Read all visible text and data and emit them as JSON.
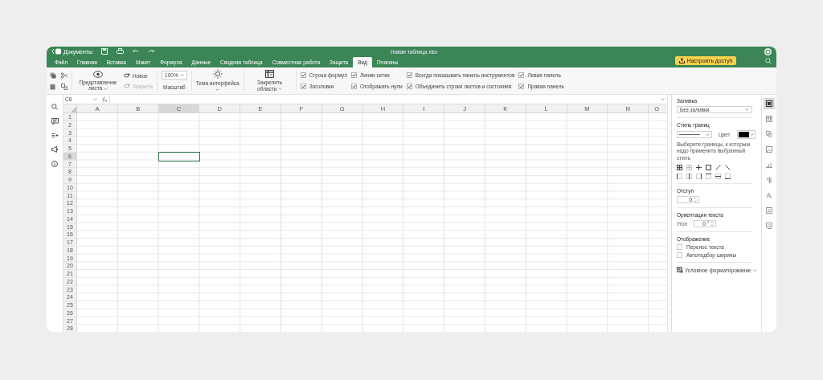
{
  "header": {
    "back_label": "Документы",
    "title": "Новая таблица.xlsx",
    "share_button": "Настроить доступ"
  },
  "menu": [
    {
      "label": "Файл",
      "selected": false
    },
    {
      "label": "Главная",
      "selected": false
    },
    {
      "label": "Вставка",
      "selected": false
    },
    {
      "label": "Макет",
      "selected": false
    },
    {
      "label": "Формула",
      "selected": false
    },
    {
      "label": "Данные",
      "selected": false
    },
    {
      "label": "Сводная таблица",
      "selected": false
    },
    {
      "label": "Совместная работа",
      "selected": false
    },
    {
      "label": "Защита",
      "selected": false
    },
    {
      "label": "Вид",
      "selected": true
    },
    {
      "label": "Плагины",
      "selected": false
    }
  ],
  "toolbar": {
    "sheet_view": "Представление листа",
    "new_view": "Новое",
    "close_view": {
      "label": "Закрыть",
      "disabled": true
    },
    "zoom_value": "100%",
    "zoom_label": "Масштаб",
    "theme": "Тема интерфейса",
    "freeze": "Закрепить области",
    "checkbox_columns": [
      {
        "items": [
          {
            "label": "Строка формул",
            "checked": true
          },
          {
            "label": "Заголовки",
            "checked": true
          }
        ]
      },
      {
        "items": [
          {
            "label": "Линии сетки",
            "checked": true
          },
          {
            "label": "Отображать нули",
            "checked": true
          }
        ]
      },
      {
        "items": [
          {
            "label": "Всегда показывать панель инструментов",
            "checked": true
          },
          {
            "label": "Объединить строки листов и состояния",
            "checked": true
          }
        ]
      },
      {
        "items": [
          {
            "label": "Левая панель",
            "checked": true
          },
          {
            "label": "Правая панель",
            "checked": true
          }
        ]
      }
    ]
  },
  "formula_bar": {
    "cell_ref": "C6"
  },
  "grid": {
    "columns": [
      {
        "label": "A",
        "selected": false
      },
      {
        "label": "B",
        "selected": false
      },
      {
        "label": "C",
        "selected": true
      },
      {
        "label": "D",
        "selected": false
      },
      {
        "label": "E",
        "selected": false
      },
      {
        "label": "F",
        "selected": false
      },
      {
        "label": "G",
        "selected": false
      },
      {
        "label": "H",
        "selected": false
      },
      {
        "label": "I",
        "selected": false
      },
      {
        "label": "J",
        "selected": false
      },
      {
        "label": "K",
        "selected": false
      },
      {
        "label": "L",
        "selected": false
      },
      {
        "label": "M",
        "selected": false
      },
      {
        "label": "N",
        "selected": false
      },
      {
        "label": "O",
        "selected": false
      }
    ],
    "rows": [
      {
        "label": "1",
        "selected": false
      },
      {
        "label": "2",
        "selected": false
      },
      {
        "label": "3",
        "selected": false
      },
      {
        "label": "4",
        "selected": false
      },
      {
        "label": "5",
        "selected": false
      },
      {
        "label": "6",
        "selected": true
      },
      {
        "label": "7",
        "selected": false
      },
      {
        "label": "8",
        "selected": false
      },
      {
        "label": "9",
        "selected": false
      },
      {
        "label": "10",
        "selected": false
      },
      {
        "label": "11",
        "selected": false
      },
      {
        "label": "12",
        "selected": false
      },
      {
        "label": "13",
        "selected": false
      },
      {
        "label": "14",
        "selected": false
      },
      {
        "label": "15",
        "selected": false
      },
      {
        "label": "16",
        "selected": false
      },
      {
        "label": "17",
        "selected": false
      },
      {
        "label": "18",
        "selected": false
      },
      {
        "label": "19",
        "selected": false
      },
      {
        "label": "20",
        "selected": false
      },
      {
        "label": "21",
        "selected": false
      },
      {
        "label": "22",
        "selected": false
      },
      {
        "label": "23",
        "selected": false
      },
      {
        "label": "24",
        "selected": false
      },
      {
        "label": "25",
        "selected": false
      },
      {
        "label": "26",
        "selected": false
      },
      {
        "label": "27",
        "selected": false
      },
      {
        "label": "28",
        "selected": false
      }
    ]
  },
  "panel": {
    "fill_label": "Заливка",
    "fill_value": "Без заливки",
    "border_style_label": "Стиль границ",
    "color_label": "Цвет",
    "border_color": {
      "color": "#000000"
    },
    "border_hint": "Выберите границы, к которым надо применить выбранный стиль",
    "indent_label": "Отступ",
    "indent_value": "0",
    "orientation_label": "Ориентация текста",
    "angle_label": "Угол",
    "angle_value": "0 °",
    "display_label": "Отображение",
    "display_options": [
      {
        "label": "Перенос текста",
        "checked": false
      },
      {
        "label": "Автоподбор ширины",
        "checked": false
      }
    ],
    "conditional_formatting": "Условное форматирование"
  },
  "side_tabs": [
    {
      "kind": "cell",
      "selected": true
    },
    {
      "kind": "table",
      "selected": false
    },
    {
      "kind": "shape",
      "selected": false
    },
    {
      "kind": "image",
      "selected": false
    },
    {
      "kind": "chart",
      "selected": false
    },
    {
      "kind": "paragraph",
      "selected": false
    },
    {
      "kind": "textart",
      "selected": false
    },
    {
      "kind": "slicer",
      "selected": false
    },
    {
      "kind": "signature",
      "selected": false
    }
  ]
}
